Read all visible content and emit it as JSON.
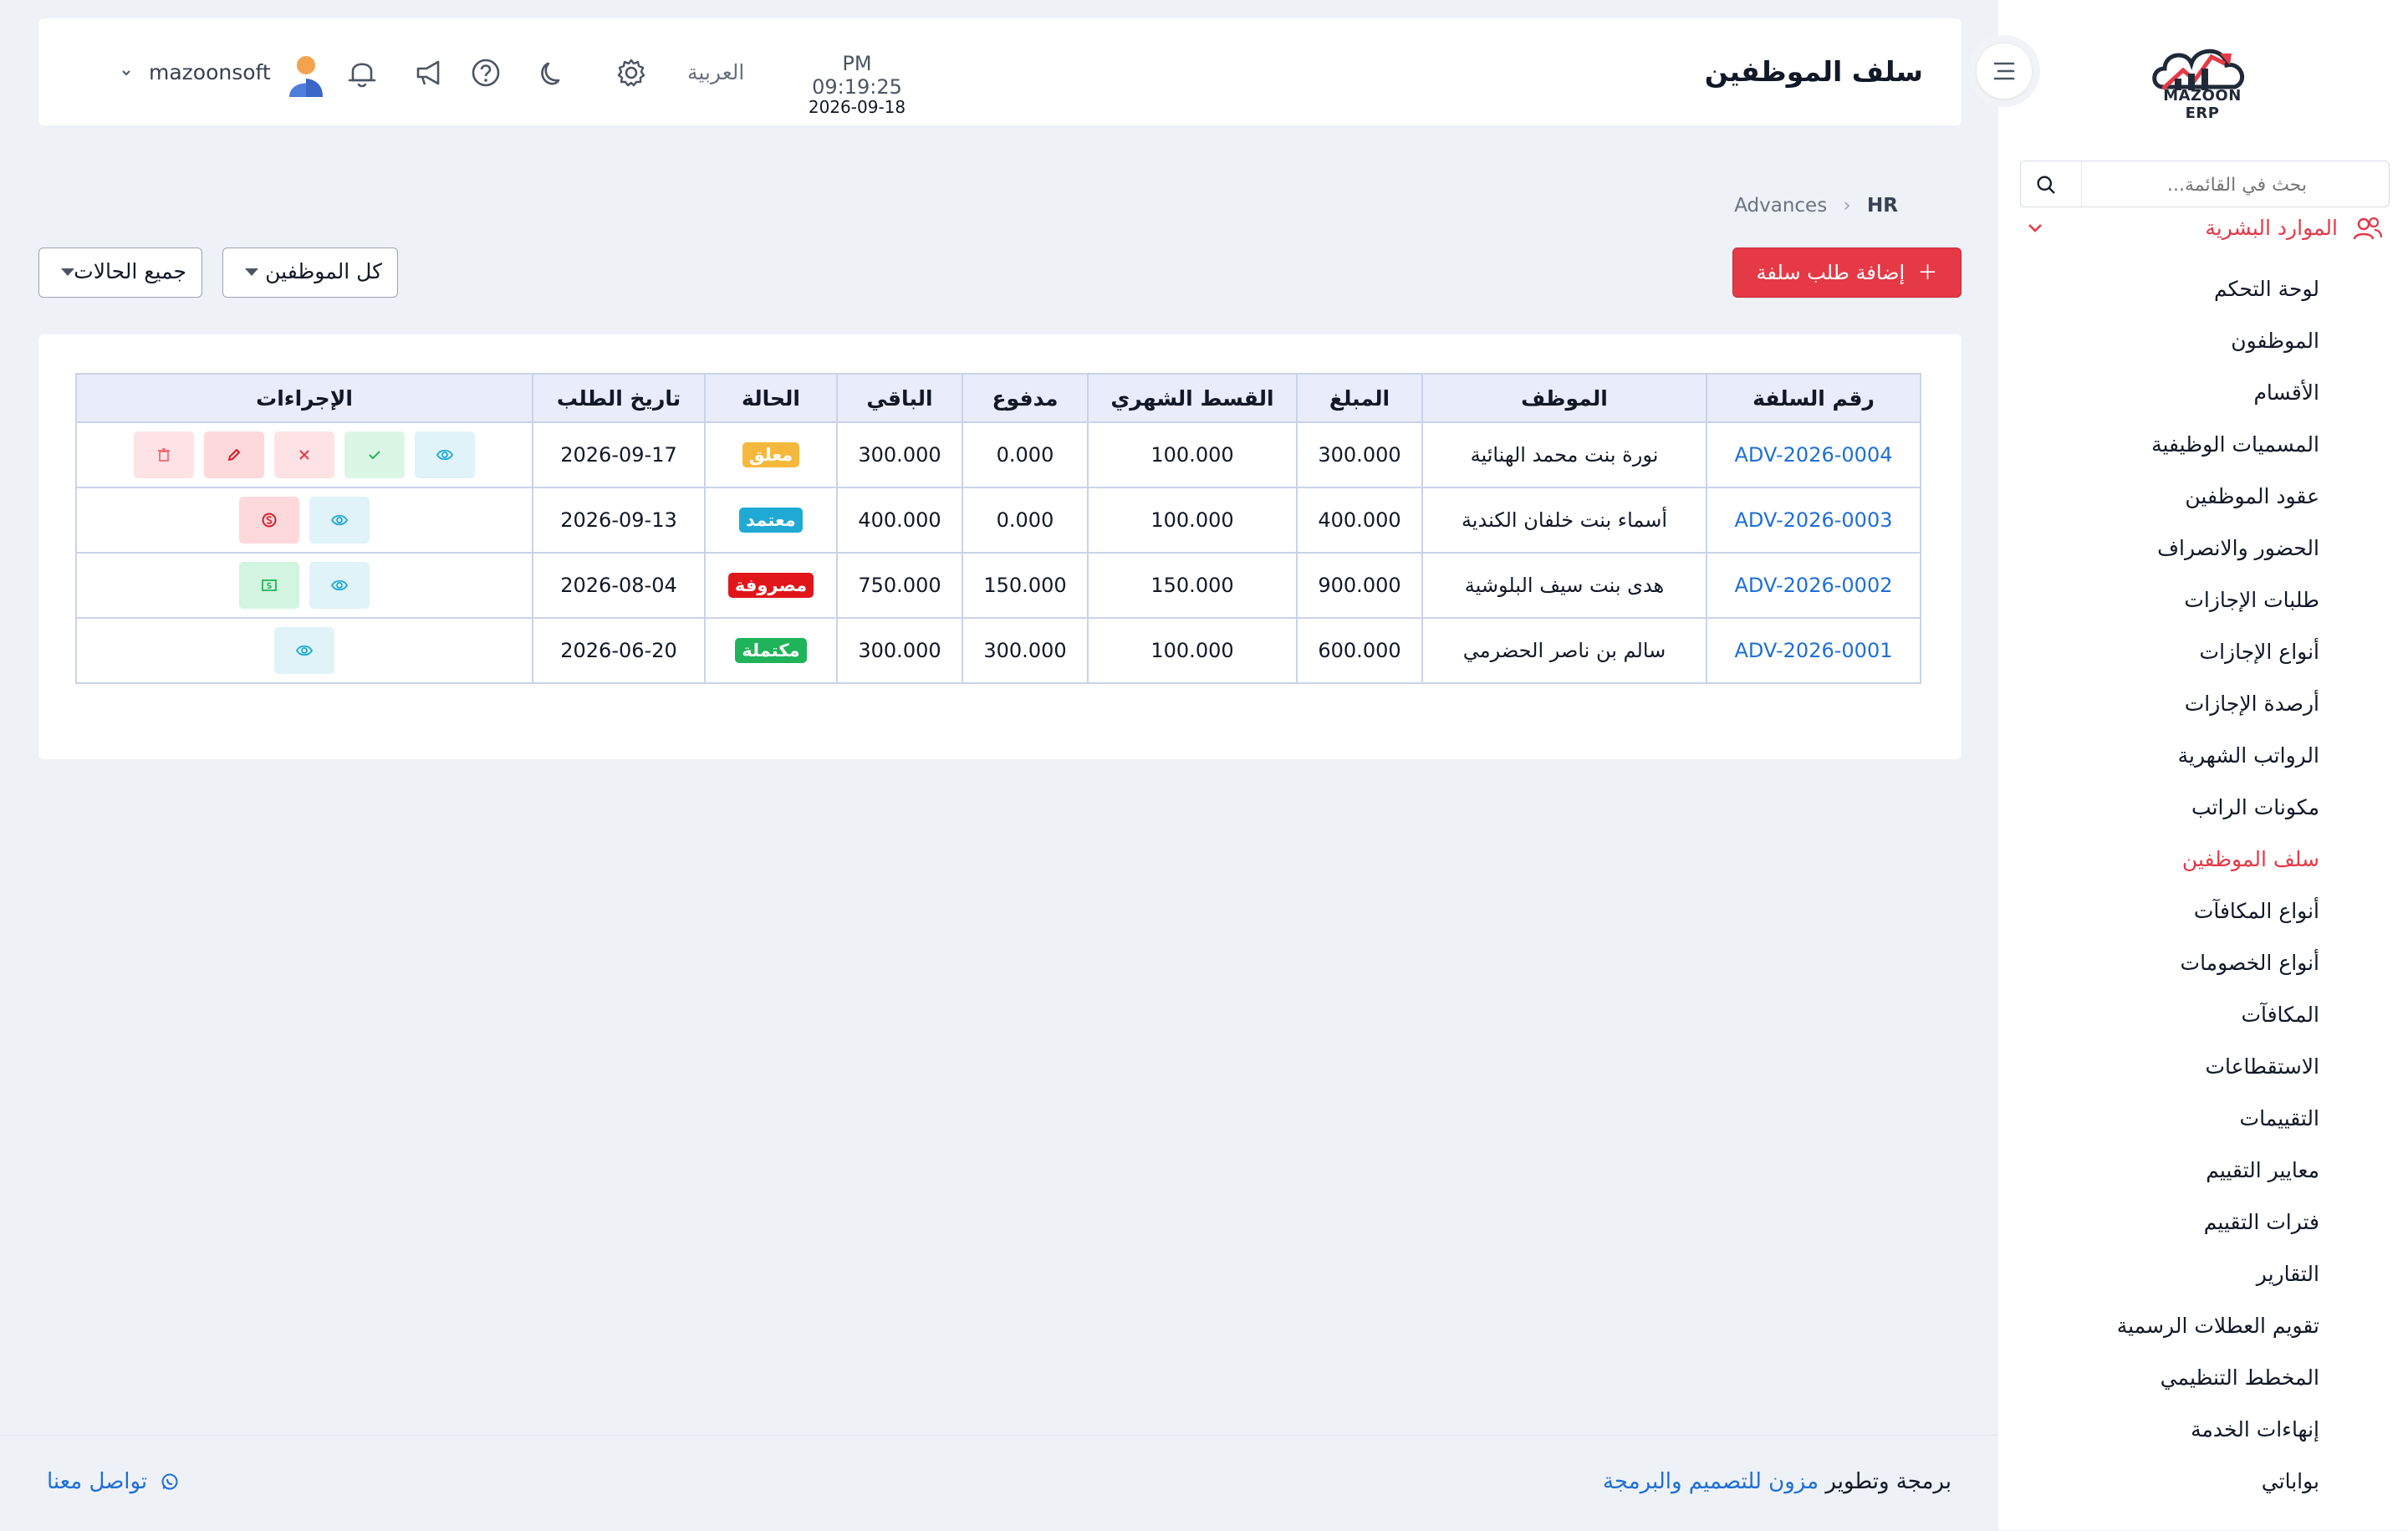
{
  "sidebar": {
    "logo_text": "MAZOON ERP",
    "search_placeholder": "بحث في القائمة...",
    "group_label": "الموارد البشرية",
    "items": [
      {
        "label": "لوحة التحكم"
      },
      {
        "label": "الموظفون"
      },
      {
        "label": "الأقسام"
      },
      {
        "label": "المسميات الوظيفية"
      },
      {
        "label": "عقود الموظفين"
      },
      {
        "label": "الحضور والانصراف"
      },
      {
        "label": "طلبات الإجازات"
      },
      {
        "label": "أنواع الإجازات"
      },
      {
        "label": "أرصدة الإجازات"
      },
      {
        "label": "الرواتب الشهرية"
      },
      {
        "label": "مكونات الراتب"
      },
      {
        "label": "سلف الموظفين",
        "active": true
      },
      {
        "label": "أنواع المكافآت"
      },
      {
        "label": "أنواع الخصومات"
      },
      {
        "label": "المكافآت"
      },
      {
        "label": "الاستقطاعات"
      },
      {
        "label": "التقييمات"
      },
      {
        "label": "معايير التقييم"
      },
      {
        "label": "فترات التقييم"
      },
      {
        "label": "التقارير"
      },
      {
        "label": "تقويم العطلات الرسمية"
      },
      {
        "label": "المخطط التنظيمي"
      },
      {
        "label": "إنهاءات الخدمة"
      },
      {
        "label": "بواباتي"
      }
    ]
  },
  "header": {
    "title": "سلف الموظفين",
    "time": "PM 09:19:25",
    "date": "2026-09-18",
    "language": "العربية",
    "username": "mazoonsoft",
    "icons": [
      "gear-icon",
      "moon-icon",
      "help-icon",
      "megaphone-icon",
      "bell-icon"
    ]
  },
  "breadcrumb": {
    "root": "HR",
    "current": "Advances"
  },
  "toolbar": {
    "add_label": "إضافة طلب سلفة",
    "filter_employees": "كل الموظفين",
    "filter_status": "جميع الحالات"
  },
  "table": {
    "headers": {
      "id": "رقم السلفة",
      "employee": "الموظف",
      "amount": "المبلغ",
      "installment": "القسط الشهري",
      "paid": "مدفوع",
      "remaining": "الباقي",
      "status": "الحالة",
      "date": "تاريخ الطلب",
      "actions": "الإجراءات"
    },
    "rows": [
      {
        "id": "ADV-2026-0004",
        "employee": "نورة بنت محمد الهنائية",
        "amount": "300.000",
        "installment": "100.000",
        "paid": "0.000",
        "remaining": "300.000",
        "status": "معلق",
        "status_color": "#f4b83d",
        "date": "2026-09-17",
        "actions": [
          "view",
          "approve",
          "reject",
          "edit",
          "delete"
        ]
      },
      {
        "id": "ADV-2026-0003",
        "employee": "أسماء بنت خلفان الكندية",
        "amount": "400.000",
        "installment": "100.000",
        "paid": "0.000",
        "remaining": "400.000",
        "status": "معتمد",
        "status_color": "#1fa9d4",
        "date": "2026-09-13",
        "actions": [
          "view",
          "pay"
        ]
      },
      {
        "id": "ADV-2026-0002",
        "employee": "هدى بنت سيف البلوشية",
        "amount": "900.000",
        "installment": "150.000",
        "paid": "150.000",
        "remaining": "750.000",
        "status": "مصروفة",
        "status_color": "#e0161b",
        "date": "2026-08-04",
        "actions": [
          "view",
          "cash"
        ]
      },
      {
        "id": "ADV-2026-0001",
        "employee": "سالم بن ناصر الحضرمي",
        "amount": "600.000",
        "installment": "100.000",
        "paid": "300.000",
        "remaining": "300.000",
        "status": "مكتملة",
        "status_color": "#1fb35a",
        "date": "2026-06-20",
        "actions": [
          "view"
        ]
      }
    ]
  },
  "footer": {
    "credit_prefix": "برمجة وتطوير",
    "credit_brand": "مزون للتصميم والبرمجة",
    "contact": "تواصل معنا"
  },
  "colors": {
    "accent": "#e53946",
    "link": "#1e6fd6",
    "table_header": "#e9ecfb"
  }
}
